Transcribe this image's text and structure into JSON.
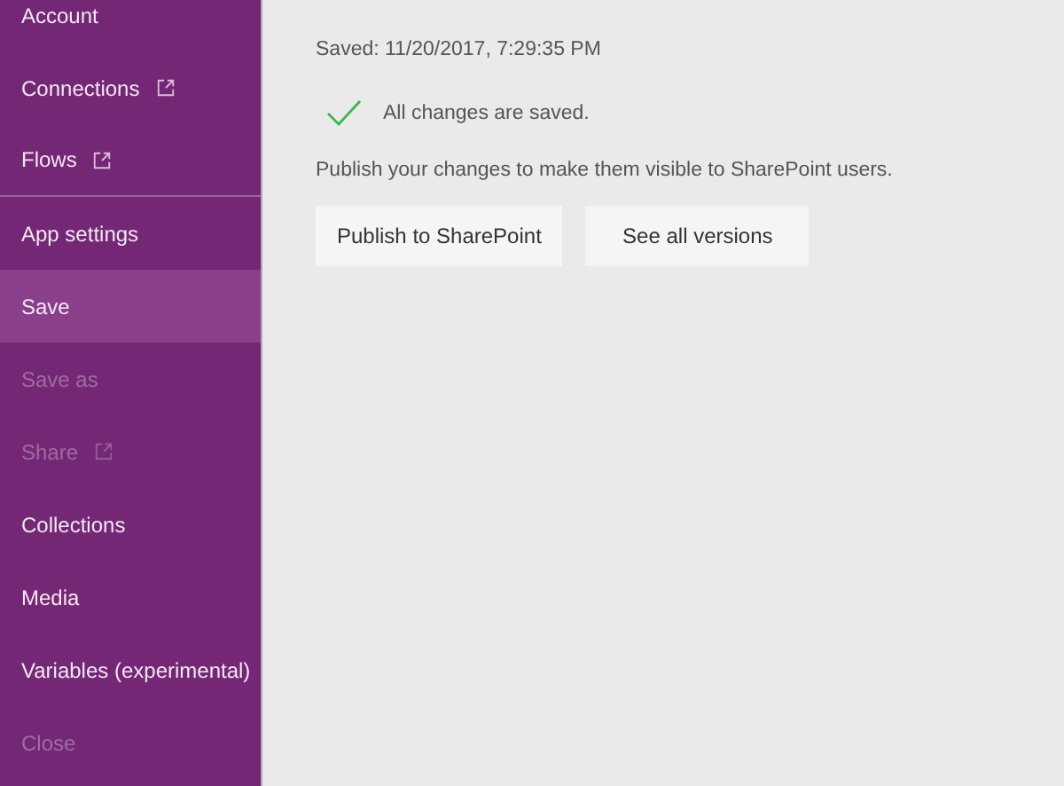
{
  "sidebar": {
    "items": [
      {
        "label": "Account",
        "external": false,
        "selected": false,
        "disabled": false,
        "separated": false
      },
      {
        "label": "Connections",
        "external": true,
        "selected": false,
        "disabled": false,
        "separated": false
      },
      {
        "label": "Flows",
        "external": true,
        "selected": false,
        "disabled": false,
        "separated": true
      },
      {
        "label": "App settings",
        "external": false,
        "selected": false,
        "disabled": false,
        "separated": false
      },
      {
        "label": "Save",
        "external": false,
        "selected": true,
        "disabled": false,
        "separated": false
      },
      {
        "label": "Save as",
        "external": false,
        "selected": false,
        "disabled": true,
        "separated": false
      },
      {
        "label": "Share",
        "external": true,
        "selected": false,
        "disabled": true,
        "separated": false
      },
      {
        "label": "Collections",
        "external": false,
        "selected": false,
        "disabled": false,
        "separated": false
      },
      {
        "label": "Media",
        "external": false,
        "selected": false,
        "disabled": false,
        "separated": false
      },
      {
        "label": "Variables (experimental)",
        "external": false,
        "selected": false,
        "disabled": false,
        "separated": false
      },
      {
        "label": "Close",
        "external": false,
        "selected": false,
        "disabled": true,
        "separated": false
      }
    ]
  },
  "main": {
    "saved_time": "Saved: 11/20/2017, 7:29:35 PM",
    "status": "All changes are saved.",
    "message": "Publish your changes to make them visible to SharePoint users.",
    "buttons": [
      "Publish to SharePoint",
      "See all versions"
    ]
  }
}
